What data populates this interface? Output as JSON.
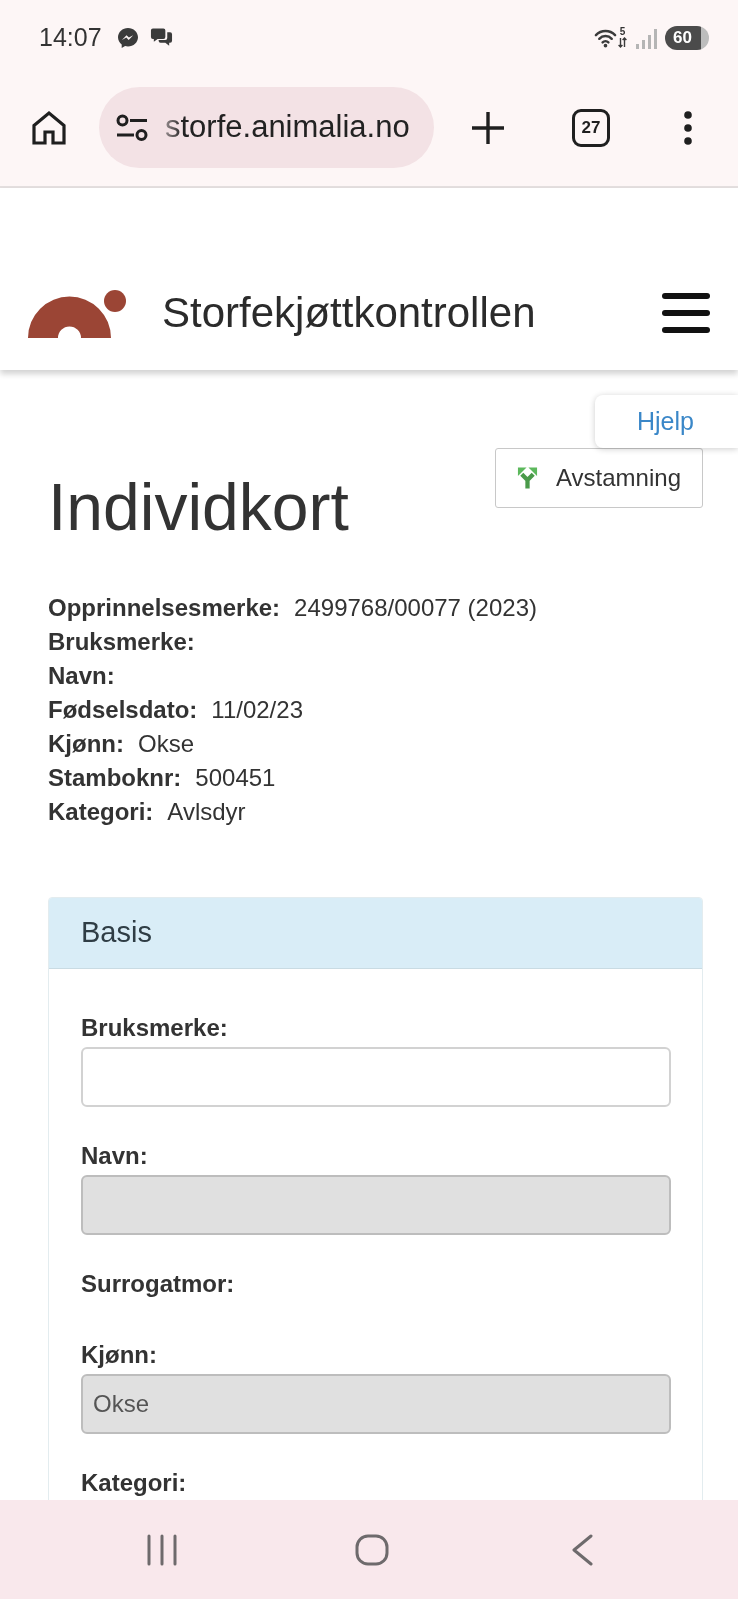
{
  "status_bar": {
    "time": "14:07",
    "wifi_label": "5",
    "battery": "60"
  },
  "browser": {
    "url": "storfe.animalia.no",
    "tab_count": "27"
  },
  "site_header": {
    "title": "Storfekjøttkontrollen"
  },
  "help_link": {
    "label": "Hjelp"
  },
  "pedigree_button": {
    "label": "Avstamning"
  },
  "page_title": "Individkort",
  "summary": [
    {
      "label": "Opprinnelsesmerke:",
      "value": "2499768/00077 (2023)"
    },
    {
      "label": "Bruksmerke:"
    },
    {
      "label": "Navn:"
    },
    {
      "label": "Fødselsdato:",
      "value": "11/02/23"
    },
    {
      "label": "Kjønn:",
      "value": "Okse"
    },
    {
      "label": "Stamboknr:",
      "value": "500451"
    },
    {
      "label": "Kategori:",
      "value": "Avlsdyr"
    }
  ],
  "panel": {
    "title": "Basis",
    "fields": [
      {
        "kind": "input",
        "label": "Bruksmerke:",
        "disabled": false
      },
      {
        "kind": "input",
        "label": "Navn:",
        "disabled": true
      },
      {
        "kind": "text",
        "label": "Surrogatmor:"
      },
      {
        "kind": "input",
        "label": "Kjønn:",
        "value": "Okse",
        "disabled": true
      },
      {
        "kind": "text",
        "label": "Kategori:"
      }
    ]
  }
}
